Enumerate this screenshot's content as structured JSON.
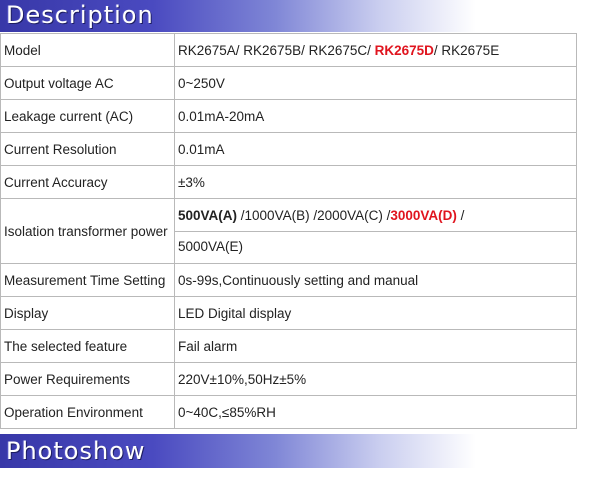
{
  "banners": {
    "description": "Description",
    "photoshow": "Photoshow"
  },
  "spec_rows": [
    {
      "label": "Model",
      "value_parts": [
        {
          "text": "RK2675A/ RK2675B/ RK2675C/  ",
          "red": false
        },
        {
          "text": "RK2675D",
          "red": true
        },
        {
          "text": "/ RK2675E",
          "red": false
        }
      ]
    },
    {
      "label": "Output voltage AC",
      "value": "0~250V"
    },
    {
      "label": "Leakage current (AC)",
      "value": "0.01mA-20mA"
    },
    {
      "label": "Current Resolution",
      "value": "0.01mA"
    },
    {
      "label": "Current Accuracy",
      "value": "±3%"
    },
    {
      "label": "Isolation transformer power",
      "line1_parts": [
        {
          "text": "500VA(A)",
          "bold": true
        },
        {
          "text": " /1000VA(B) /2000VA(C) /",
          "bold": false
        },
        {
          "text": "3000VA(D)",
          "red": true
        },
        {
          "text": " /",
          "bold": false
        }
      ],
      "line2": "5000VA(E)"
    },
    {
      "label": "Measurement Time Setting",
      "value": "0s-99s,Continuously setting and manual"
    },
    {
      "label": "Display",
      "value": "LED Digital display"
    },
    {
      "label": "The selected feature",
      "value": "Fail alarm"
    },
    {
      "label": "Power Requirements",
      "value": "220V±10%,50Hz±5%"
    },
    {
      "label": "Operation Environment",
      "value": "0~40C,≤85%RH"
    }
  ]
}
